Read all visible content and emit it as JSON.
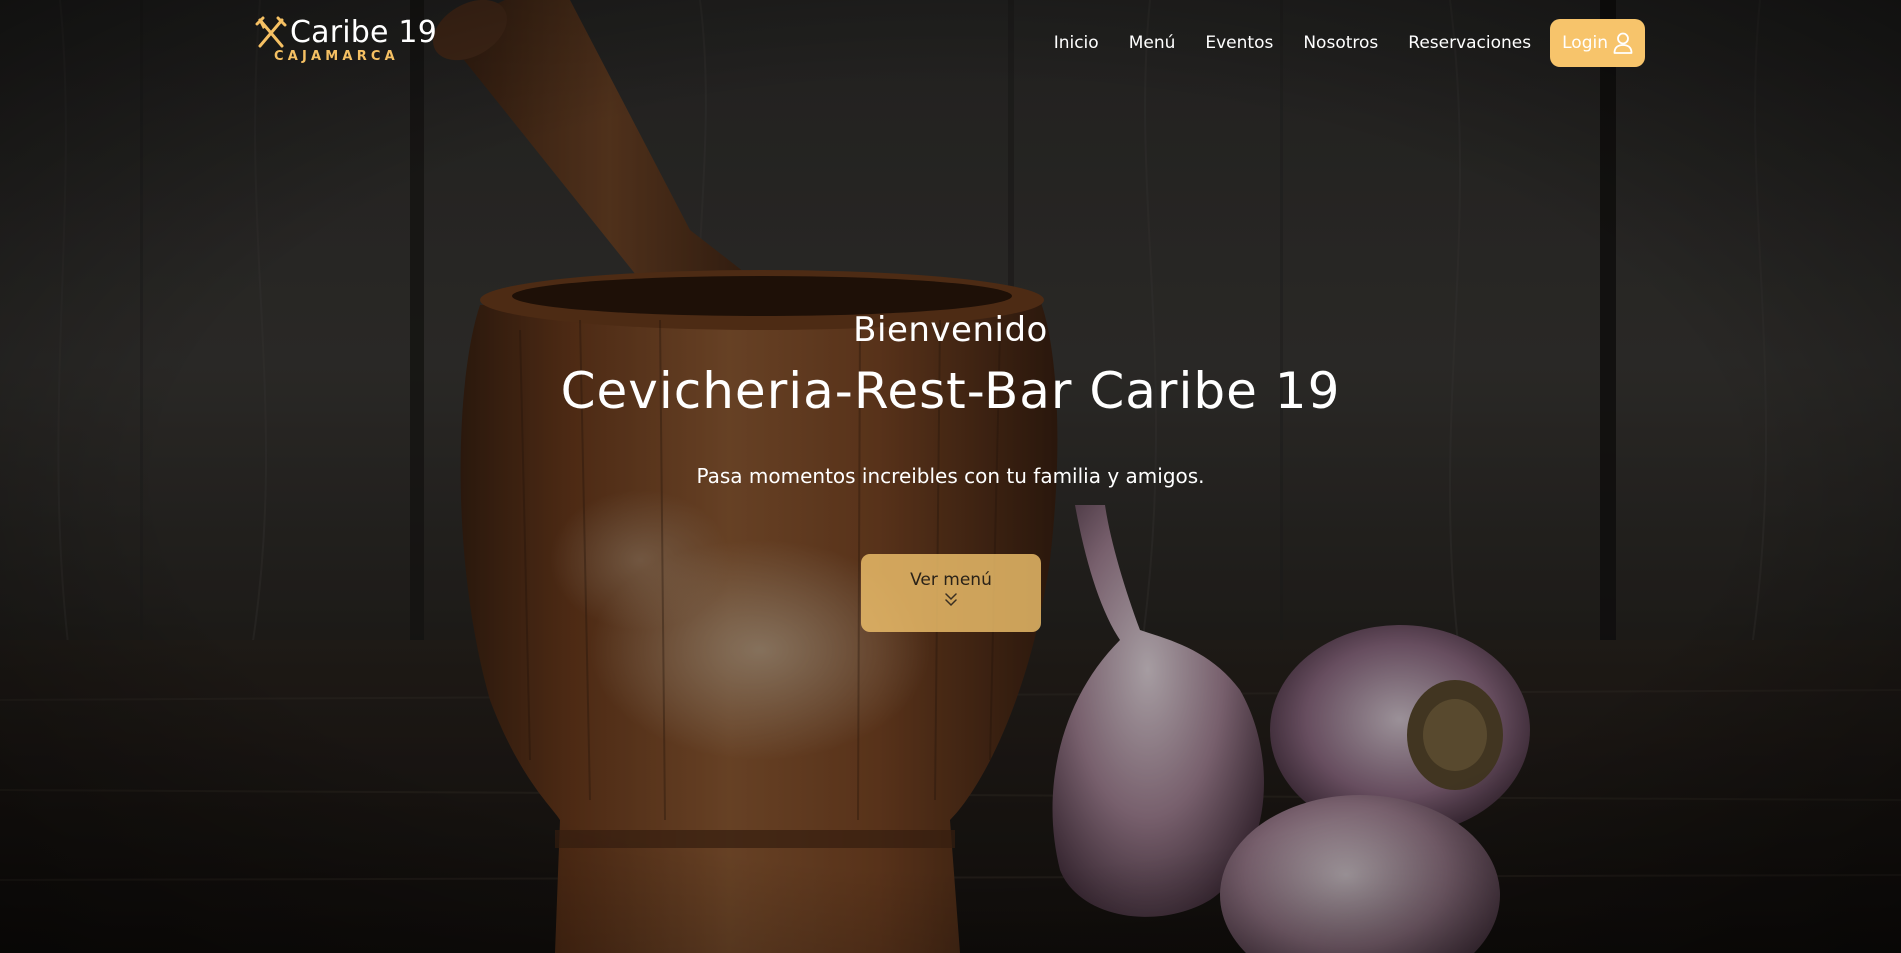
{
  "brand": {
    "name": "Caribe 19",
    "city": "CAJAMARCA",
    "logo_icon": "crossed-fork-knife-icon"
  },
  "nav": {
    "items": [
      {
        "label": "Inicio"
      },
      {
        "label": "Menú"
      },
      {
        "label": "Eventos"
      },
      {
        "label": "Nosotros"
      },
      {
        "label": "Reservaciones"
      }
    ],
    "login_label": "Login",
    "login_icon": "user-icon"
  },
  "hero": {
    "welcome": "Bienvenido",
    "title": "Cevicheria-Rest-Bar Caribe 19",
    "subtitle": "Pasa momentos increibles con tu familia y amigos.",
    "cta_label": "Ver menú",
    "cta_icon": "double-chevron-down-icon"
  },
  "colors": {
    "accent": "#f7c46b",
    "text": "#ffffff"
  }
}
